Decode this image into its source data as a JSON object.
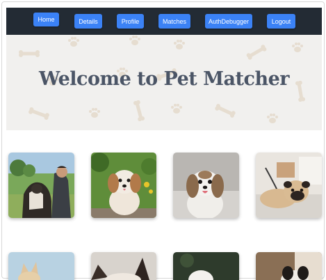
{
  "nav": {
    "items": [
      "Home",
      "Details",
      "Profile",
      "Matches",
      "AuthDebugger",
      "Logout"
    ]
  },
  "hero": {
    "title": "Welcome to Pet Matcher"
  },
  "colors": {
    "navbar": "#232b34",
    "button": "#3b82f6",
    "hero_bg": "#f1f0ee",
    "title": "#4b5566"
  }
}
